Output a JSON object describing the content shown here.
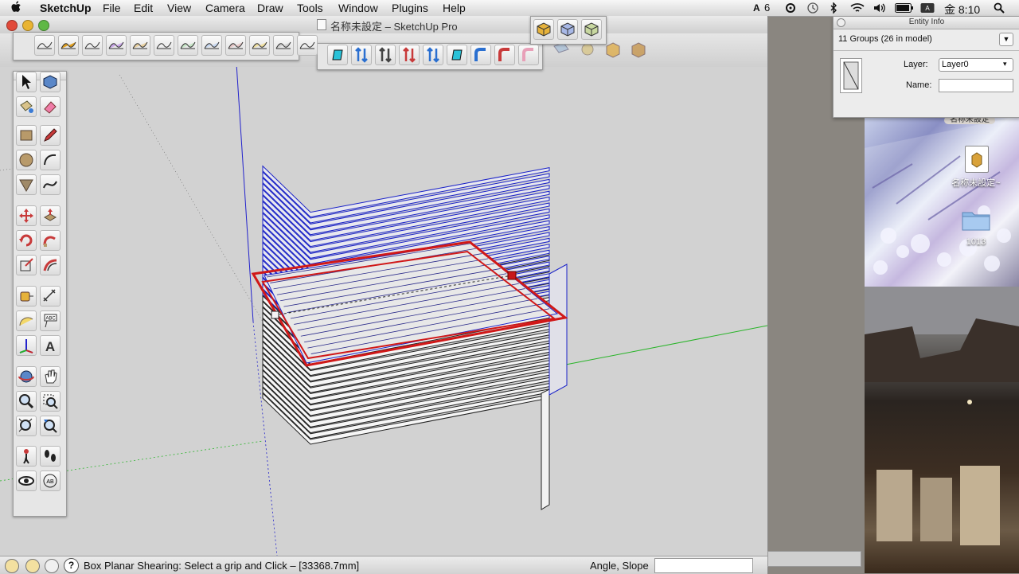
{
  "menubar": {
    "app": "SketchUp",
    "items": [
      "File",
      "Edit",
      "View",
      "Camera",
      "Draw",
      "Tools",
      "Window",
      "Plugins",
      "Help"
    ],
    "status": {
      "adobe_count": "6",
      "clock": "金 8:10"
    }
  },
  "window": {
    "title": "名称未設定 – SketchUp Pro"
  },
  "statusbar": {
    "message": "Box Planar Shearing: Select a grip and Click – [33368.7mm]",
    "measure_label": "Angle, Slope",
    "measure_value": ""
  },
  "entity_info": {
    "panel_title": "Entity Info",
    "summary": "11 Groups (26 in model)",
    "layer_label": "Layer:",
    "layer_value": "Layer0",
    "name_label": "Name:",
    "name_value": ""
  },
  "desktop": {
    "file_label": "名称未設定~",
    "folder_label": "1013",
    "photo_label": "名称未設定"
  },
  "colors": {
    "selection_blue": "#1a22c8",
    "shear_red": "#d01818",
    "axis_green": "#28b428",
    "axis_blue": "#2222cc",
    "axis_red": "#c82828"
  }
}
